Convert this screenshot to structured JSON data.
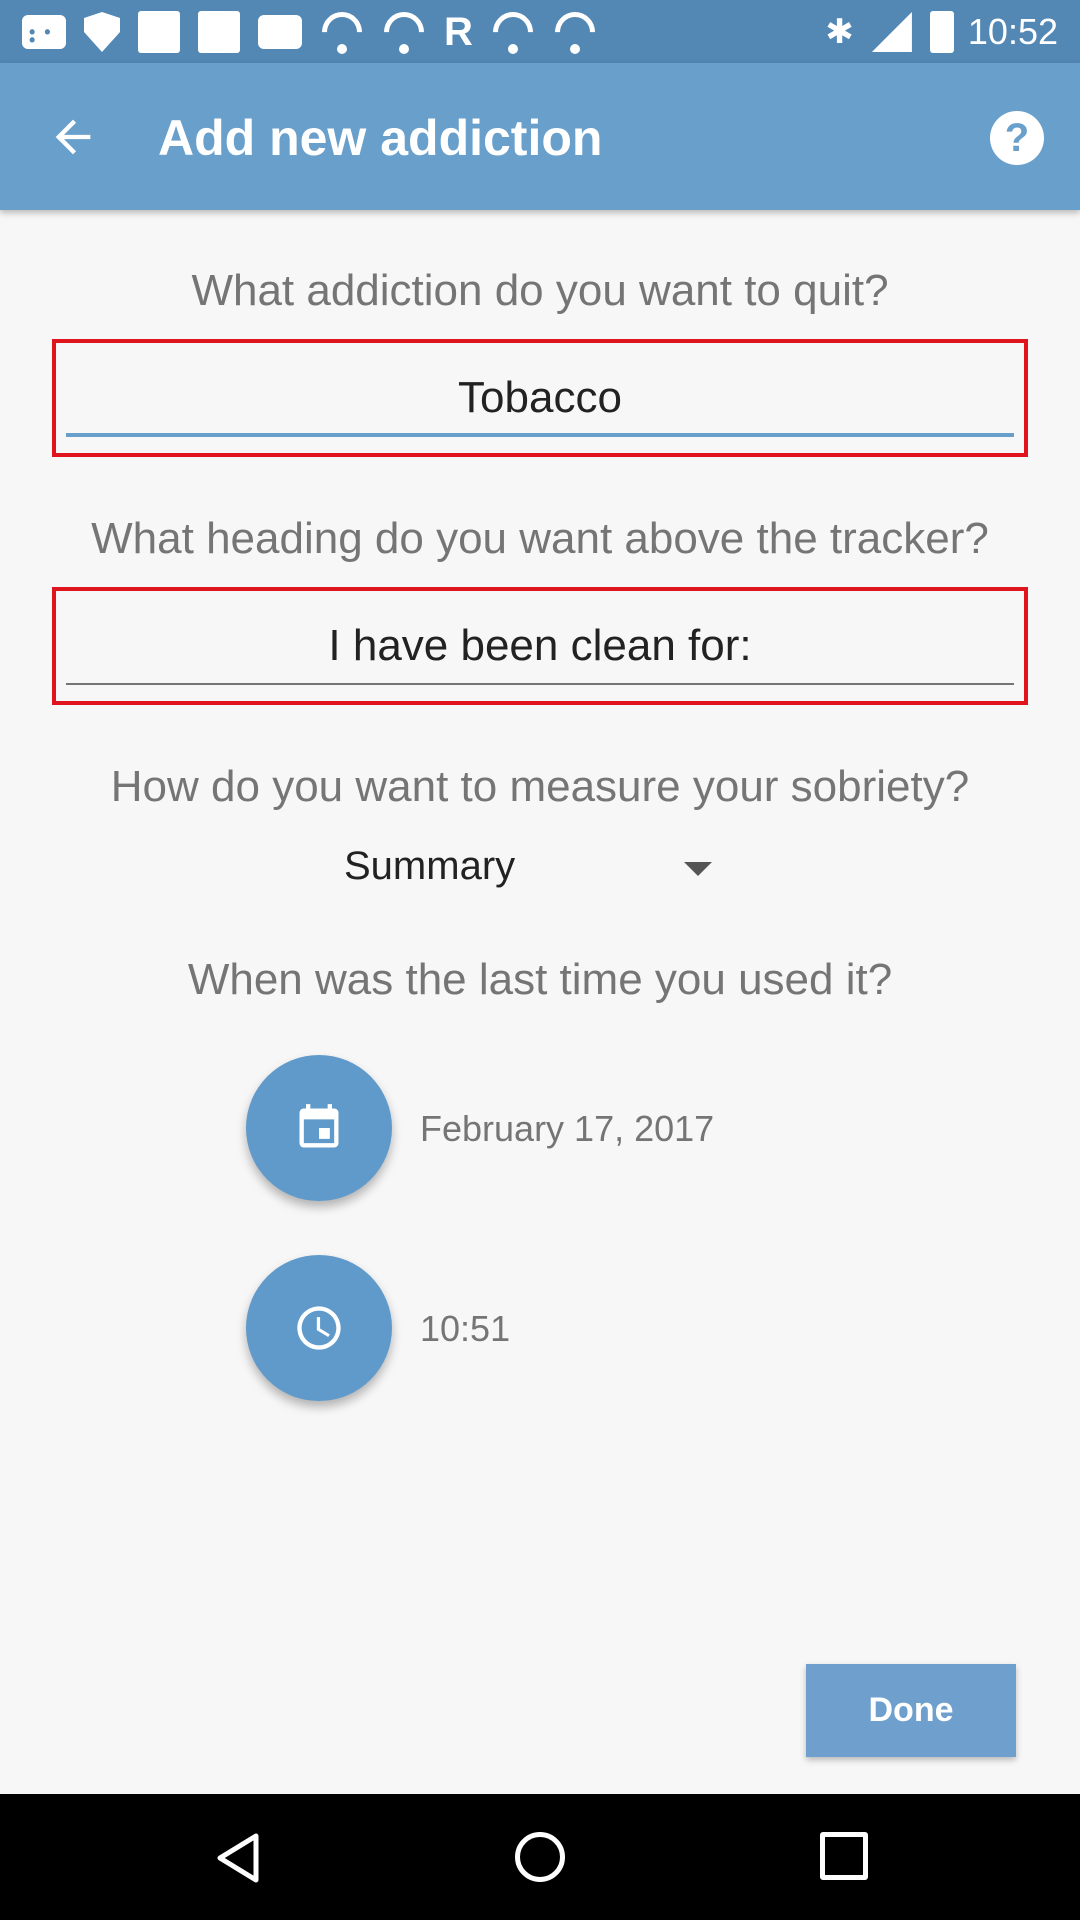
{
  "status_bar": {
    "time": "10:52",
    "icons": [
      "notification-dots-icon",
      "shield-icon",
      "square-icon",
      "square-icon",
      "robot-icon",
      "wifi-icon",
      "wifi-icon",
      "r-icon",
      "bull-icon",
      "wifi-icon",
      "bluetooth-icon",
      "signal-icon",
      "battery-icon"
    ]
  },
  "app_bar": {
    "title": "Add new addiction",
    "back_icon": "arrow-back-icon",
    "help_icon": "help-icon",
    "help_glyph": "?",
    "color": "#699fcb"
  },
  "form": {
    "addiction_question": "What addiction do you want to quit?",
    "addiction_value": "Tobacco",
    "heading_question": "What heading do you want above the tracker?",
    "heading_value": "I have been clean for:",
    "measure_question": "How do you want to measure your sobriety?",
    "measure_selected": "Summary",
    "last_used_question": "When was the last time you used it?",
    "date_value": "February 17, 2017",
    "time_value": "10:51",
    "date_icon": "calendar-icon",
    "time_icon": "clock-icon"
  },
  "actions": {
    "done_label": "Done"
  },
  "nav_bar": {
    "icons": [
      "back-triangle-icon",
      "home-circle-icon",
      "recents-square-icon"
    ]
  },
  "colors": {
    "accent": "#699fcb",
    "highlight_border": "#e0141c",
    "fab": "#5f9acb"
  }
}
